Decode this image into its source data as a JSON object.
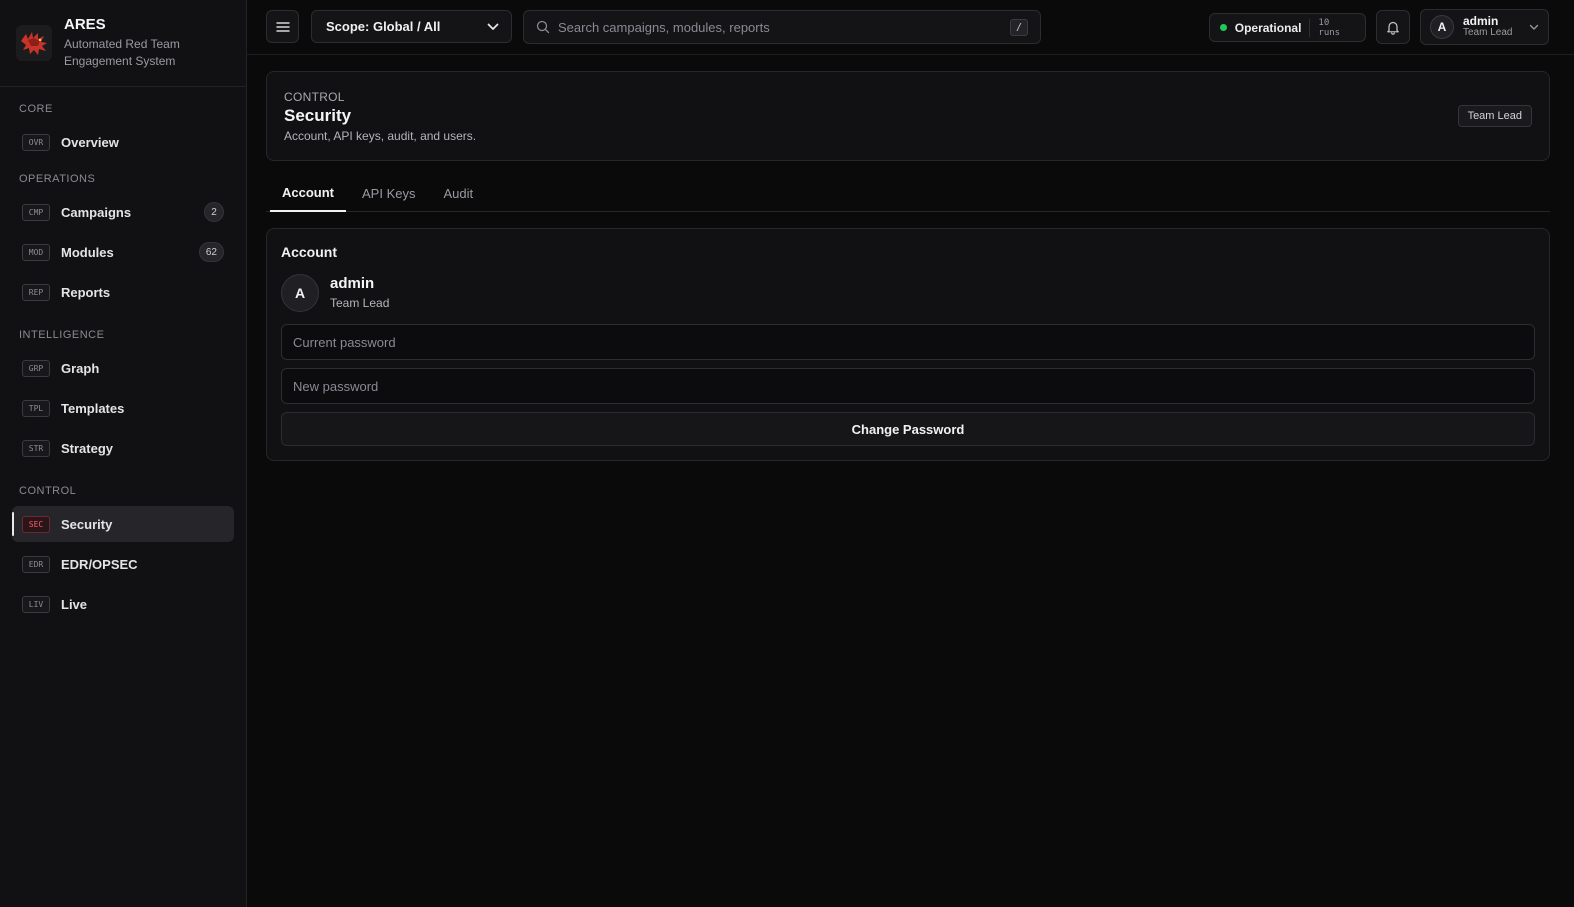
{
  "brand": {
    "name": "ARES",
    "subtitle": "Automated Red Team Engagement System",
    "logo_icon": "dragon-logo-icon",
    "accent_color": "#d13a2e"
  },
  "sidebar": {
    "sections": [
      {
        "heading": "CORE",
        "items": [
          {
            "code": "OVR",
            "label": "Overview"
          }
        ]
      },
      {
        "heading": "OPERATIONS",
        "items": [
          {
            "code": "CMP",
            "label": "Campaigns",
            "badge": "2"
          },
          {
            "code": "MOD",
            "label": "Modules",
            "badge": "62"
          },
          {
            "code": "REP",
            "label": "Reports"
          }
        ]
      },
      {
        "heading": "INTELLIGENCE",
        "items": [
          {
            "code": "GRP",
            "label": "Graph"
          },
          {
            "code": "TPL",
            "label": "Templates"
          },
          {
            "code": "STR",
            "label": "Strategy"
          }
        ]
      },
      {
        "heading": "CONTROL",
        "items": [
          {
            "code": "SEC",
            "label": "Security",
            "active": true
          },
          {
            "code": "EDR",
            "label": "EDR/OPSEC"
          },
          {
            "code": "LIV",
            "label": "Live"
          }
        ]
      }
    ]
  },
  "topbar": {
    "scope_label": "Scope: Global / All",
    "search_placeholder": "Search campaigns, modules, reports",
    "search_shortcut": "/",
    "status_text": "Operational",
    "status_runs": "10 runs",
    "status_color": "#22c55e",
    "user_initial": "A",
    "user_name": "admin",
    "user_role": "Team Lead"
  },
  "page": {
    "breadcrumb": "CONTROL",
    "title": "Security",
    "description": "Account, API keys, audit, and users.",
    "role_badge": "Team Lead"
  },
  "tabs": [
    {
      "label": "Account",
      "active": true
    },
    {
      "label": "API Keys"
    },
    {
      "label": "Audit"
    }
  ],
  "account": {
    "title": "Account",
    "avatar_initial": "A",
    "name": "admin",
    "role": "Team Lead",
    "current_password_placeholder": "Current password",
    "new_password_placeholder": "New password",
    "change_button": "Change Password"
  }
}
